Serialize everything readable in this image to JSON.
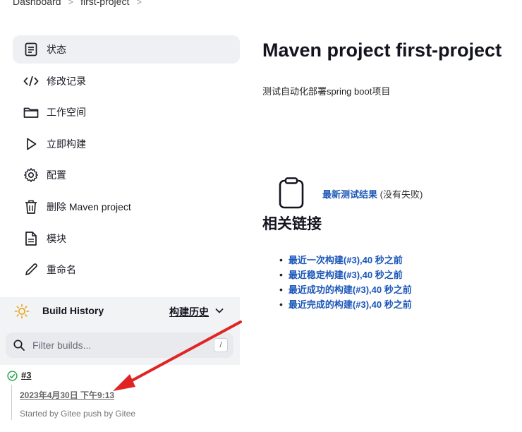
{
  "breadcrumb": {
    "items": [
      "Dashboard",
      "first-project"
    ]
  },
  "sidebar": {
    "items": [
      {
        "label": "状态",
        "icon": "status-doc-icon"
      },
      {
        "label": "修改记录",
        "icon": "code-icon"
      },
      {
        "label": "工作空间",
        "icon": "folder-icon"
      },
      {
        "label": "立即构建",
        "icon": "play-icon"
      },
      {
        "label": "配置",
        "icon": "gear-icon"
      },
      {
        "label": "删除 Maven project",
        "icon": "trash-icon"
      },
      {
        "label": "模块",
        "icon": "file-icon"
      },
      {
        "label": "重命名",
        "icon": "pencil-icon"
      }
    ]
  },
  "build_history": {
    "title": "Build History",
    "trend_label": "构建历史",
    "filter_placeholder": "Filter builds...",
    "filter_shortcut": "/",
    "builds": [
      {
        "number": "#3",
        "date": "2023年4月30日 下午9:13",
        "cause": "Started by Gitee push by Gitee",
        "status": "success"
      }
    ]
  },
  "main": {
    "title": "Maven project first-project",
    "description": "测试自动化部署spring boot项目",
    "test_result_link": "最新测试结果",
    "test_result_note": "(没有失败)",
    "related_title": "相关链接",
    "related_links": [
      "最近一次构建(#3),40 秒之前",
      "最近稳定构建(#3),40 秒之前",
      "最近成功的构建(#3),40 秒之前",
      "最近完成的构建(#3),40 秒之前"
    ]
  },
  "colors": {
    "link": "#1a56b8",
    "annotation_arrow": "#e02424",
    "success": "#1ea446"
  }
}
